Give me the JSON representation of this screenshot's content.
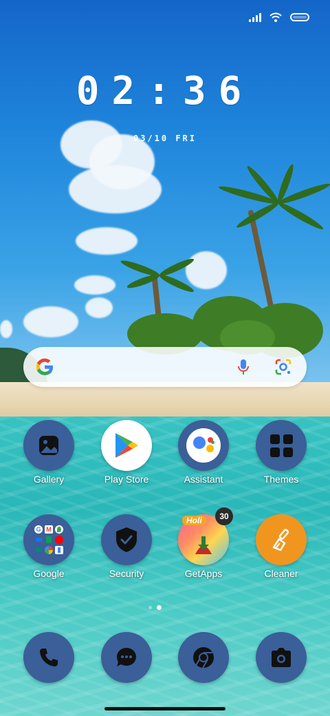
{
  "status_bar": {
    "signal_icon": "signal-icon",
    "wifi_icon": "wifi-icon",
    "battery_icon": "battery-icon"
  },
  "clock": {
    "time": "02:36",
    "date": "03/10 FRI"
  },
  "search_bar": {
    "logo_icon": "google-g-icon",
    "mic_icon": "mic-icon",
    "lens_icon": "google-lens-icon"
  },
  "apps": [
    {
      "label": "Gallery",
      "icon": "gallery-icon"
    },
    {
      "label": "Play Store",
      "icon": "play-store-icon"
    },
    {
      "label": "Assistant",
      "icon": "assistant-icon"
    },
    {
      "label": "Themes",
      "icon": "themes-icon"
    },
    {
      "label": "Google",
      "icon": "google-folder-icon"
    },
    {
      "label": "Security",
      "icon": "security-shield-icon"
    },
    {
      "label": "GetApps",
      "icon": "getapps-icon",
      "badge": "30"
    },
    {
      "label": "Cleaner",
      "icon": "cleaner-brush-icon"
    }
  ],
  "getapps_banner": "Holi",
  "dock": [
    {
      "icon": "phone-icon"
    },
    {
      "icon": "messages-icon"
    },
    {
      "icon": "chrome-icon"
    },
    {
      "icon": "camera-icon"
    }
  ],
  "colors": {
    "icon_blue": "#3b5f98",
    "cleaner_orange": "#f0961f"
  }
}
